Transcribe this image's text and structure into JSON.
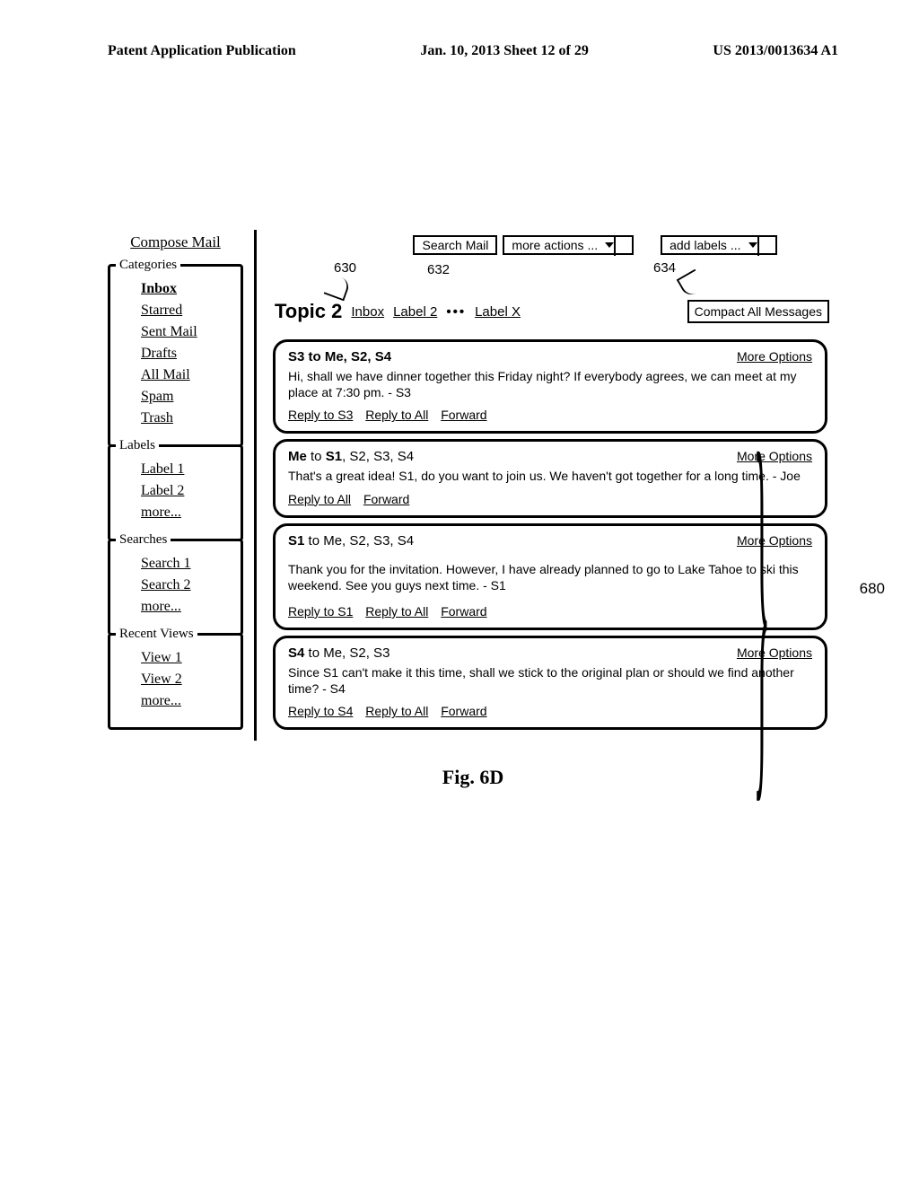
{
  "header": {
    "left": "Patent Application Publication",
    "mid": "Jan. 10, 2013  Sheet 12 of 29",
    "right": "US 2013/0013634 A1"
  },
  "sidebar": {
    "compose": "Compose Mail",
    "categories_legend": "Categories",
    "categories": [
      "Inbox",
      "Starred",
      "Sent Mail",
      "Drafts",
      "All Mail",
      "Spam",
      "Trash"
    ],
    "labels_legend": "Labels",
    "labels": [
      "Label 1",
      "Label 2",
      "more..."
    ],
    "searches_legend": "Searches",
    "searches": [
      "Search 1",
      "Search 2",
      "more..."
    ],
    "recent_legend": "Recent Views",
    "recent": [
      "View 1",
      "View 2",
      "more..."
    ]
  },
  "toolbar": {
    "search": "Search Mail",
    "more": "more actions ...",
    "add": "add labels ..."
  },
  "leadnums": {
    "a": "630",
    "b": "632",
    "c": "634"
  },
  "topic": {
    "title": "Topic 2",
    "inbox": "Inbox",
    "label2": "Label 2",
    "labelx": "Label X",
    "compact": "Compact All Messages"
  },
  "msgs": [
    {
      "from": "S3 to Me, S2, S4",
      "more": "More Options",
      "body": "Hi, shall we have dinner together this Friday night? If everybody agrees, we can meet at my place at 7:30 pm. - S3",
      "actions": [
        "Reply to S3",
        "Reply to All",
        "Forward"
      ]
    },
    {
      "from_html": "<b>Me</b> to <b>S1</b>, S2, S3, S4",
      "more": "More Options",
      "body": "That's a great idea! S1, do you want to join us. We haven't got together for a long time. - Joe",
      "actions": [
        "Reply to All",
        "Forward"
      ]
    },
    {
      "from_html": "<b>S1</b> to Me, S2, S3, S4",
      "more": "More Options",
      "body": "Thank you for the invitation. However, I have already planned to go to Lake Tahoe to ski this weekend. See you guys next time. - S1",
      "actions": [
        "Reply to S1",
        "Reply to All",
        "Forward"
      ]
    },
    {
      "from_html": "<b>S4</b> to Me, S2, S3",
      "more": "More Options",
      "body": "Since S1 can't make it this time, shall we stick to the original plan or should we find another time? - S4",
      "actions": [
        "Reply to S4",
        "Reply to All",
        "Forward"
      ]
    }
  ],
  "braceref": "680",
  "figure": "Fig. 6D"
}
